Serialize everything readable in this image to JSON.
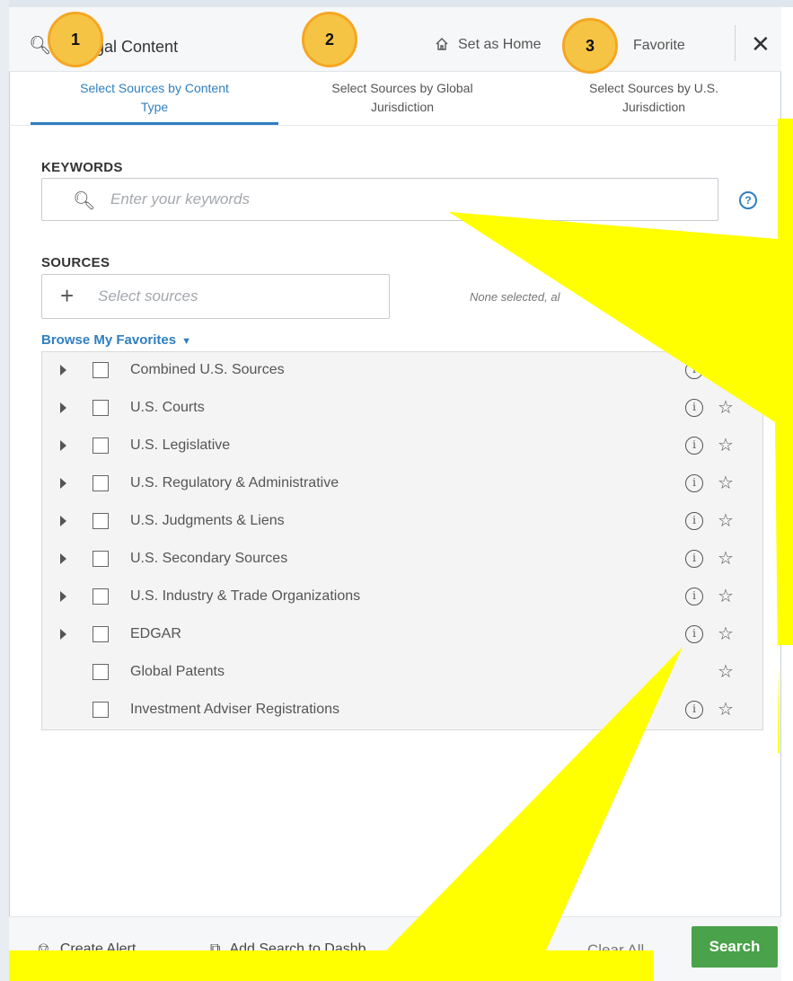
{
  "header": {
    "title": "gal Content",
    "set_home_label": "Set as Home",
    "favorite_label": "Favorite",
    "close_label": "✕"
  },
  "tabs": [
    {
      "line1": "Select Sources by Content",
      "line2": "Type"
    },
    {
      "line1": "Select Sources by Global",
      "line2": "Jurisdiction"
    },
    {
      "line1": "Select Sources by U.S.",
      "line2": "Jurisdiction"
    }
  ],
  "keywords": {
    "label": "KEYWORDS",
    "placeholder": "Enter your keywords",
    "help_label": "?"
  },
  "sources": {
    "label": "SOURCES",
    "placeholder": "Select sources",
    "status": "None selected, al"
  },
  "browse_label": "Browse My Favorites",
  "source_list": [
    {
      "name": "Combined U.S. Sources"
    },
    {
      "name": "U.S. Courts"
    },
    {
      "name": "U.S. Legislative"
    },
    {
      "name": "U.S. Regulatory & Administrative"
    },
    {
      "name": "U.S. Judgments & Liens"
    },
    {
      "name": "U.S. Secondary Sources"
    },
    {
      "name": "U.S. Industry & Trade Organizations"
    },
    {
      "name": "EDGAR"
    },
    {
      "name": "Global Patents"
    },
    {
      "name": "Investment Adviser Registrations"
    }
  ],
  "footer": {
    "create_alert": "Create Alert",
    "add_dashboard": "Add Search to Dashb",
    "clear_all": "Clear All",
    "search": "Search"
  },
  "annotations": [
    "1",
    "2",
    "3"
  ],
  "colors": {
    "accent": "#2f7fc1",
    "search_button": "#4aa24a",
    "highlight_yellow": "#ffff00",
    "badge": "#f6c445"
  }
}
